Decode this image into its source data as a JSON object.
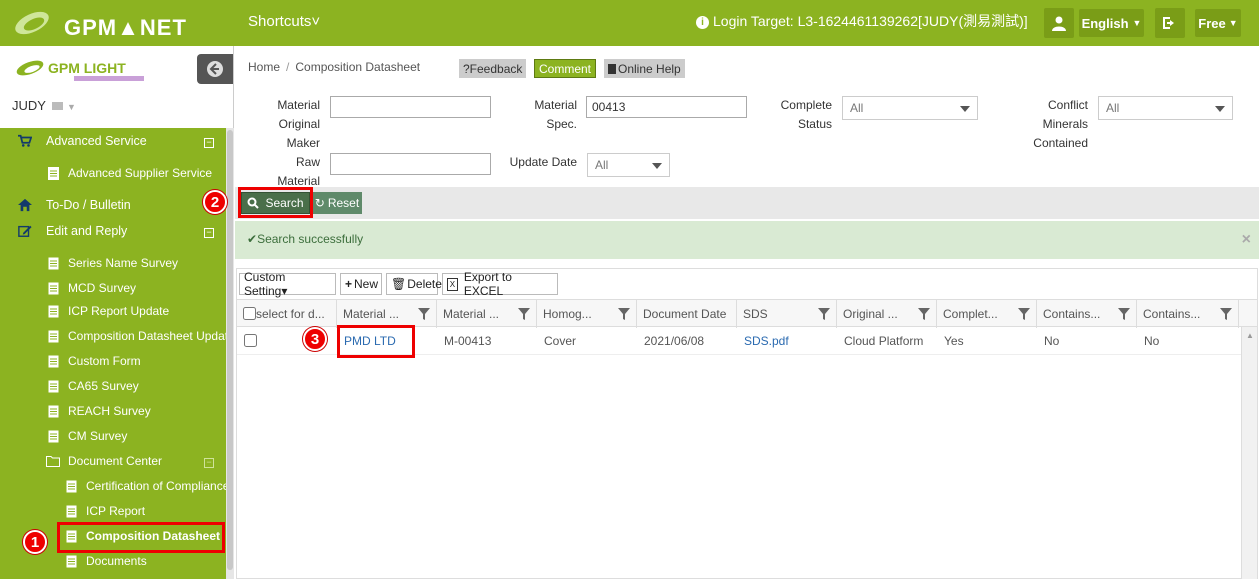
{
  "topbar": {
    "logo": "GPM▲NET",
    "shortcuts": "Shortcuts˅",
    "login_target": "Login Target: L3-1624461139262[JUDY(測易測試)]",
    "language": "English",
    "plan": "Free"
  },
  "sidebar": {
    "logo": "GPM LIGHT",
    "user": "JUDY",
    "items": [
      {
        "label": "Advanced Service",
        "icon": "cart-icon"
      },
      {
        "label": "Advanced Supplier Service",
        "icon": "document-icon"
      },
      {
        "label": "To-Do / Bulletin",
        "icon": "home-icon"
      },
      {
        "label": "Edit and Reply",
        "icon": "edit-icon"
      },
      {
        "label": "Series Name Survey",
        "icon": "document-icon"
      },
      {
        "label": "MCD Survey",
        "icon": "document-icon"
      },
      {
        "label": "ICP Report Update",
        "icon": "document-icon"
      },
      {
        "label": "Composition Datasheet Update",
        "icon": "document-icon"
      },
      {
        "label": "Custom Form",
        "icon": "document-icon"
      },
      {
        "label": "CA65 Survey",
        "icon": "document-icon"
      },
      {
        "label": "REACH Survey",
        "icon": "document-icon"
      },
      {
        "label": "CM Survey",
        "icon": "document-icon"
      },
      {
        "label": "Document Center",
        "icon": "folder-icon"
      },
      {
        "label": "Certification of Compliance",
        "icon": "document-icon"
      },
      {
        "label": "ICP Report",
        "icon": "document-icon"
      },
      {
        "label": "Composition Datasheet",
        "icon": "document-icon"
      },
      {
        "label": "Documents",
        "icon": "document-icon"
      }
    ]
  },
  "breadcrumb": {
    "home": "Home",
    "current": "Composition Datasheet"
  },
  "header_buttons": {
    "feedback": "?Feedback",
    "comment": "Comment",
    "help": "Online Help"
  },
  "filters": {
    "material_original_maker_label": "Material Original Maker",
    "material_original_maker_value": "",
    "material_spec_label": "Material Spec.",
    "material_spec_value": "00413",
    "complete_status_label": "Complete Status",
    "complete_status_value": "All",
    "conflict_minerals_label": "Conflict Minerals Contained",
    "conflict_minerals_value": "All",
    "raw_material_label": "Raw Material",
    "raw_material_value": "",
    "update_date_label": "Update Date",
    "update_date_value": "All"
  },
  "actions": {
    "search": "Search",
    "reset": "Reset"
  },
  "alert": {
    "message": "Search successfully",
    "close": "×"
  },
  "toolbar": {
    "custom": "Custom Setting▾",
    "new": "New",
    "delete": "Delete",
    "export": "Export to EXCEL"
  },
  "table": {
    "columns": [
      "select for d...",
      "Material ...",
      "Material ...",
      "Homog...",
      "Document Date",
      "SDS",
      "Original ...",
      "Complet...",
      "Contains...",
      "Contains..."
    ],
    "rows": [
      [
        "",
        "PMD LTD",
        "M-00413",
        "Cover",
        "2021/06/08",
        "SDS.pdf",
        "Cloud Platform",
        "Yes",
        "No",
        "No"
      ]
    ]
  },
  "annotations": {
    "step1": "1",
    "step2": "2",
    "step3": "3"
  },
  "colors": {
    "brand_green": "#8cb321",
    "highlight_red": "#e00000"
  }
}
